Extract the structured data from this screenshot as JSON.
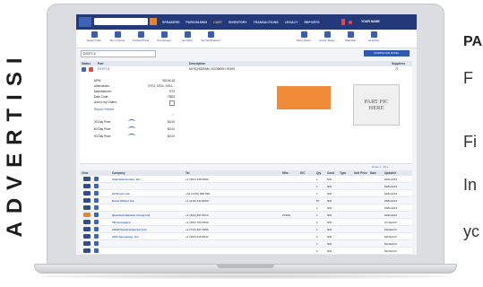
{
  "side_text": "ADVERTISI",
  "promo": {
    "title": "PA",
    "line1": "F",
    "line2": "Fi",
    "line3": "In",
    "line4": "yc"
  },
  "app": {
    "brand_color": "#24397a",
    "accent_color": "#e8842b",
    "nav": [
      "SPEAKERS",
      "PURCHASING",
      "CART",
      "INVENTORY",
      "TRANSACTIONS",
      "LEGACY",
      "REPORTS"
    ],
    "active_nav_index": 2,
    "user": "YOUR NAME",
    "toolbar": [
      "Quick Order",
      "Buy a Quote",
      "Tracked Parts",
      "Set Ranges",
      "Set RFQ",
      "Set Notifications",
      "RFQ Status",
      "Quote Status",
      "Watchlist",
      "Activities"
    ],
    "part_search": "DS3TT-8",
    "download_button": "DOWNLOAD EXCEL",
    "part_header": {
      "columns": [
        "Status",
        "Part",
        "Description",
        "Suppliers"
      ],
      "row": {
        "part": "DS3TT-8",
        "description": "MYSQ/SDRAM, SOOBEEH ROHS",
        "suppliers": "71"
      }
    },
    "details": [
      {
        "k": "MPN:",
        "v": "BD1M-18"
      },
      {
        "k": "Alternatives:",
        "v": "ETS1, DS11, DS11..."
      },
      {
        "k": "Manufacturer:",
        "v": "ST3"
      },
      {
        "k": "Date Code:",
        "v": "TBD3"
      },
      {
        "k": "Add to my Orders:",
        "v": ""
      }
    ],
    "report_link": "Report Problem",
    "prices": [
      {
        "label": "30 Day Price:",
        "v": "$0.00"
      },
      {
        "label": "60 Day Price:",
        "v": "$0.00"
      },
      {
        "label": "90 Day Price:",
        "v": "$0.00"
      }
    ],
    "part_pic_text": "PART PIC HERE",
    "pager": "Rows 1 - 50 ▸",
    "supplier_columns": [
      "View",
      "Company",
      "Tel",
      "Mfrs",
      "D/C",
      "Qty",
      "Cond",
      "Type",
      "Unit Price",
      "Date",
      "Updated"
    ],
    "suppliers": [
      {
        "n": "1",
        "company": "Alien Electronics, Inc.",
        "tel": "+1 (503) 338-3500",
        "mfr": "",
        "dc": "",
        "qty": "1",
        "cond": "NW",
        "date": "02/Feb/23",
        "orange": false
      },
      {
        "n": "2",
        "company": "",
        "tel": "",
        "mfr": "",
        "dc": "",
        "qty": "1",
        "cond": "NW",
        "date": "02/Feb/23",
        "orange": false
      },
      {
        "n": "3",
        "company": "UCTronic Ltd.",
        "tel": "+44 (1375) 890 999",
        "mfr": "",
        "dc": "",
        "qty": "1",
        "cond": "NW",
        "date": "02/Feb/23",
        "orange": false
      },
      {
        "n": "4",
        "company": "Excel Silicon Inc.",
        "tel": "+1 (216) 342-8300",
        "mfr": "",
        "dc": "",
        "qty": "57",
        "cond": "NW",
        "date": "08/Feb/23",
        "orange": false
      },
      {
        "n": "5",
        "company": "",
        "tel": "",
        "mfr": "",
        "dc": "",
        "qty": "1",
        "cond": "NW",
        "date": "03/Feb/23",
        "orange": false
      },
      {
        "n": "6",
        "company": "Quantum Harbour Group Ltd",
        "tel": "+1 (303) 307-4213",
        "mfr": "",
        "dc": "2720S",
        "qty": "1",
        "cond": "NW",
        "date": "02/Feb/23",
        "orange": true
      },
      {
        "n": "7",
        "company": "TD Aerospace",
        "tel": "+1 (302) 706-3590",
        "mfr": "",
        "dc": "",
        "qty": "1",
        "cond": "NW",
        "date": "27/Jan/23",
        "orange": false
      },
      {
        "n": "8",
        "company": "ASAP Semiconductor LLC",
        "tel": "+1 (714) 397-7856",
        "mfr": "",
        "dc": "",
        "qty": "1",
        "cond": "NW",
        "date": "23/Jan/23",
        "orange": false
      },
      {
        "n": "9",
        "company": "CDC Aerospace, Inc.",
        "tel": "+1 (503) 316-8022",
        "mfr": "",
        "dc": "",
        "qty": "1",
        "cond": "NW",
        "date": "02/Jan/23",
        "orange": false
      },
      {
        "n": "10",
        "company": "",
        "tel": "",
        "mfr": "",
        "dc": "",
        "qty": "1",
        "cond": "NW",
        "date": "02/Jan/23",
        "orange": false
      },
      {
        "n": "11",
        "company": "",
        "tel": "",
        "mfr": "",
        "dc": "",
        "qty": "1",
        "cond": "NW",
        "date": "02/Jan/23",
        "orange": false
      },
      {
        "n": "12",
        "company": "Forest Aviation Ltd.",
        "tel": "+971 (2) 822-0040",
        "mfr": "",
        "dc": "",
        "qty": "1",
        "cond": "NW",
        "date": "01/Jan/23",
        "orange": false
      },
      {
        "n": "13",
        "company": "Chanson Rollen Electronics Inc.",
        "tel": "+1 (510) 327-8430",
        "mfr": "",
        "dc": "",
        "qty": "1",
        "cond": "NW",
        "date": "01/Jan/23",
        "orange": false
      }
    ]
  }
}
